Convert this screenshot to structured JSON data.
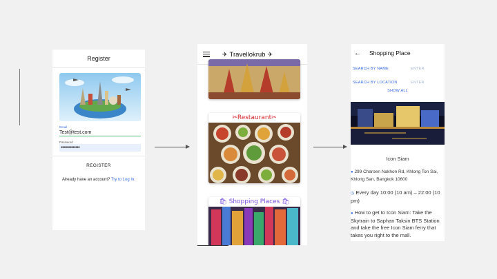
{
  "register": {
    "title": "Register",
    "email_label": "Email",
    "email_value": "Test@test.com",
    "password_label": "Password",
    "password_value": "••••••••••••••",
    "register_button": "REGISTER",
    "login_prompt": "Already have an account?",
    "login_link": "Try to Log In."
  },
  "home": {
    "title": "Travellokrub",
    "plane_icon": "✈",
    "restaurant_title": "✂Restaurant✂",
    "shopping_title": "🛍 Shopping Places 🛍"
  },
  "shopping": {
    "back_icon": "←",
    "title": "Shopping Place",
    "search_by_name_label": "SEARCH BY NAME",
    "search_by_name_placeholder": "ENTER",
    "search_by_location_label": "SEARCH BY LOCATION",
    "search_by_location_placeholder": "ENTER",
    "show_all": "SHOW ALL",
    "place_name": "Icon Siam",
    "address": "299 Charoen Nakhon Rd, Khlong Ton Sai, Khlong San, Bangkok 10600",
    "hours": "Every day 10:00 (10 am) – 22:00 (10 pm)",
    "how_to_get": "How to get to Icon Siam: Take the Skytrain to Saphan Taksin BTS Station and take the free Icon Siam ferry that takes you right to the mall."
  },
  "icons": {
    "location": "location-pin-icon",
    "clock": "clock-icon",
    "info": "info-icon"
  }
}
